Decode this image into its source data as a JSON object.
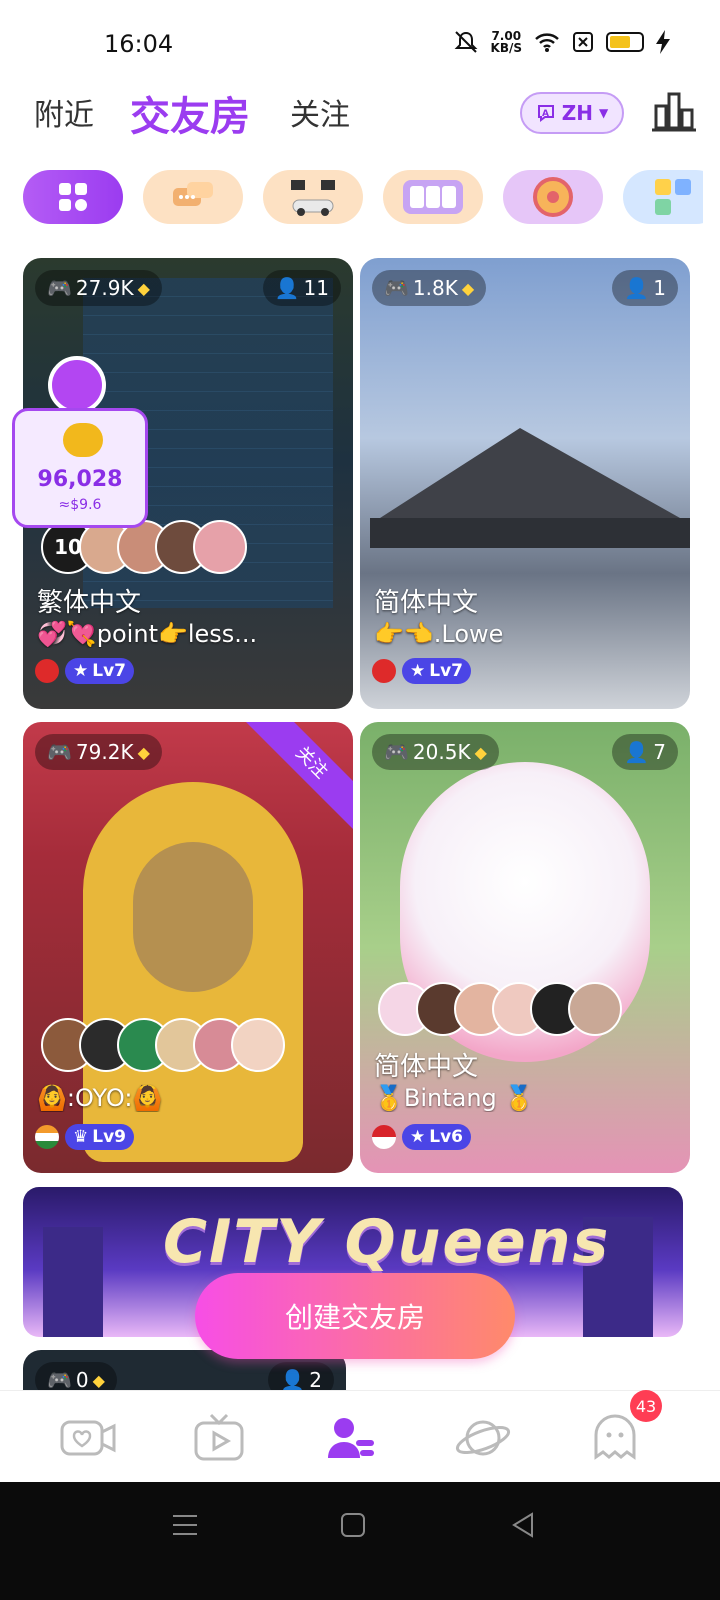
{
  "status_bar": {
    "time": "16:04",
    "net_speed_value": "7.00",
    "net_speed_unit": "KB/S"
  },
  "header": {
    "tabs": [
      {
        "label": "附近",
        "active": false
      },
      {
        "label": "交友房",
        "active": true
      },
      {
        "label": "关注",
        "active": false
      }
    ],
    "language": "ZH"
  },
  "categories": [
    "all-grid-icon",
    "chat-icon",
    "racing-icon",
    "lottery-icon",
    "wheel-icon",
    "dice-icon"
  ],
  "rooms": [
    {
      "plays": "27.9K",
      "members": "11",
      "title": "繁体中文",
      "subtitle": "💞💘point👉less...",
      "level": "Lv7",
      "online_count": "10"
    },
    {
      "plays": "1.8K",
      "members": "1",
      "title": "简体中文",
      "subtitle": "👉👈.Lowe",
      "level": "Lv7"
    },
    {
      "plays": "79.2K",
      "ribbon": "关注",
      "subtitle": "🙆:OYO:🙆",
      "level": "Lv9"
    },
    {
      "plays": "20.5K",
      "members": "7",
      "title": "简体中文",
      "subtitle": "🥇Bintang 🥇",
      "level": "Lv6"
    },
    {
      "plays": "0",
      "members": "2"
    }
  ],
  "bonus": {
    "value": "96,028",
    "usd": "≈$9.6"
  },
  "banner": {
    "title": "CITY Queens"
  },
  "create_button": "创建交友房",
  "tabbar": {
    "notification_count": "43"
  },
  "colors": {
    "accent": "#9b3cf0",
    "lv_badge": "#4b45e6",
    "cta_start": "#f74ee6",
    "cta_end": "#ff8a6a"
  }
}
